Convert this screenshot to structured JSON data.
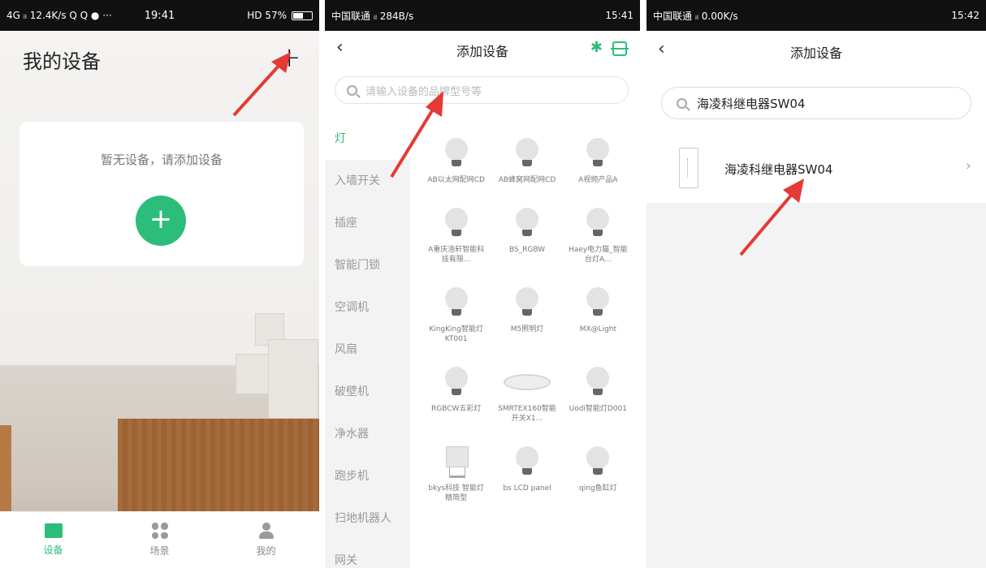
{
  "screen1": {
    "status": {
      "left": "4G ᵢₗ 12.4K/s Q Q ● ···",
      "time": "19:41",
      "right": "HD 57%"
    },
    "title": "我的设备",
    "add_symbol": "+",
    "empty_text": "暂无设备，请添加设备",
    "add_button_symbol": "+",
    "tabs": [
      {
        "label": "设备",
        "icon": "device-icon"
      },
      {
        "label": "场景",
        "icon": "scene-icon"
      },
      {
        "label": "我的",
        "icon": "profile-icon"
      }
    ]
  },
  "screen2": {
    "status": {
      "left": "中国联通 ᵢₗ 284B/s",
      "right": "15:41"
    },
    "nav": {
      "back": "‹",
      "title": "添加设备",
      "bluetooth": "✱"
    },
    "search_placeholder": "请输入设备的品牌型号等",
    "categories": [
      "灯",
      "入墙开关",
      "插座",
      "智能门锁",
      "空调机",
      "风扇",
      "破壁机",
      "净水器",
      "跑步机",
      "扫地机器人",
      "网关"
    ],
    "devices": [
      {
        "label": "AB以太网配网CD",
        "icon": "bulb-icon"
      },
      {
        "label": "AB蜂窝网配网CD",
        "icon": "bulb-icon"
      },
      {
        "label": "A视频产品A",
        "icon": "bulb-icon"
      },
      {
        "label": "A重庆浩轩智能科技有限...",
        "icon": "bulb-icon"
      },
      {
        "label": "BS_RGBW",
        "icon": "bulb-icon"
      },
      {
        "label": "Haey电力猫_智能台灯A...",
        "icon": "bulb-icon"
      },
      {
        "label": "KingKing智能灯KT001",
        "icon": "bulb-icon"
      },
      {
        "label": "M5照明灯",
        "icon": "bulb-icon"
      },
      {
        "label": "MX@Light",
        "icon": "bulb-icon"
      },
      {
        "label": "RGBCW五彩灯",
        "icon": "bulb-icon"
      },
      {
        "label": "SMRTEX160智能开关X1...",
        "icon": "panel-light-icon"
      },
      {
        "label": "Uodi智能灯D001",
        "icon": "bulb-icon"
      },
      {
        "label": "bkys科技 智能灯精简型",
        "icon": "table-lamp-icon"
      },
      {
        "label": "bs LCD panel",
        "icon": "bulb-icon"
      },
      {
        "label": "qing鱼缸灯",
        "icon": "bulb-icon"
      }
    ]
  },
  "screen3": {
    "status": {
      "left": "中国联通 ᵢₗ 0.00K/s",
      "right": "15:42"
    },
    "nav": {
      "back": "‹",
      "title": "添加设备"
    },
    "search_value": "海凌科继电器SW04",
    "result": {
      "name": "海凌科继电器SW04",
      "chevron": "›"
    }
  },
  "colors": {
    "accent": "#2dbd7a",
    "arrow": "#e53935"
  }
}
